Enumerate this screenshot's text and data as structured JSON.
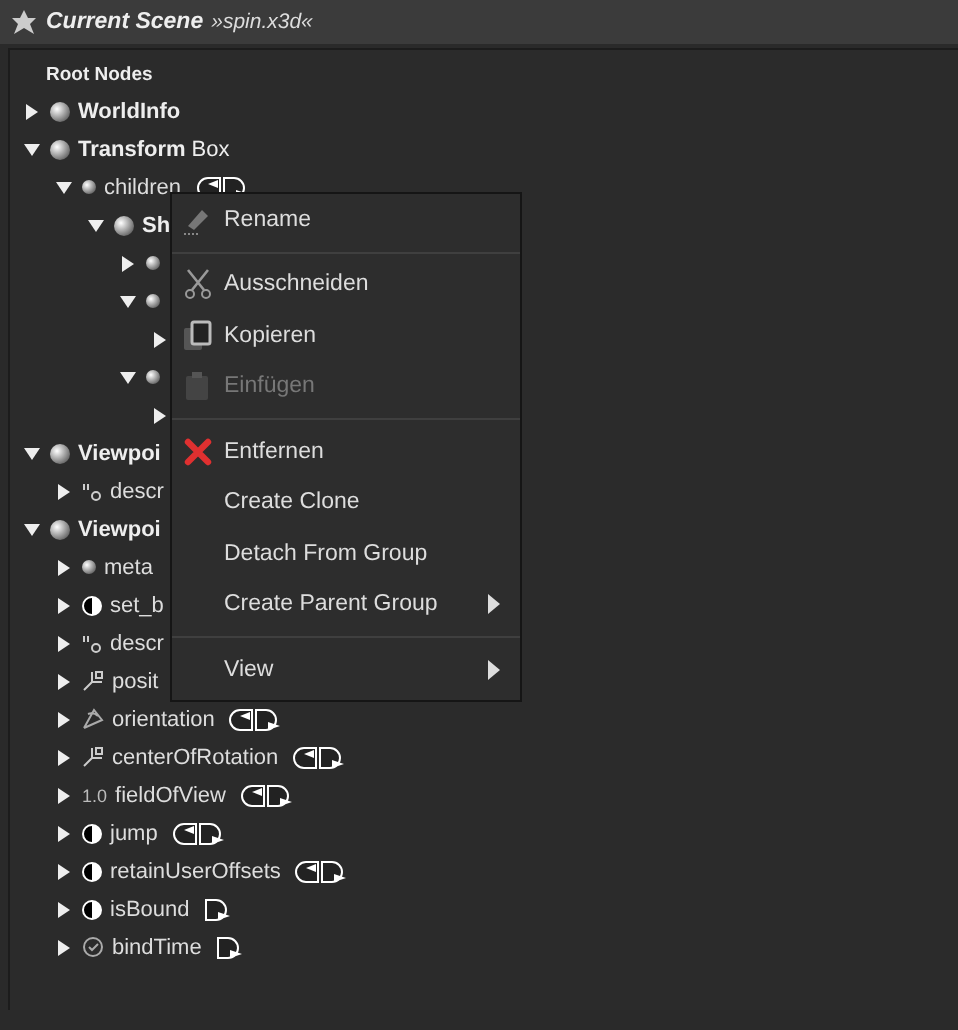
{
  "header": {
    "title": "Current Scene",
    "file": "»spin.x3d«"
  },
  "tree": {
    "heading": "Root Nodes",
    "rows": [
      {
        "kind": "node",
        "type": "WorldInfo",
        "expanded": false
      },
      {
        "kind": "node",
        "type": "Transform",
        "name": "Box",
        "expanded": true,
        "children": [
          {
            "kind": "sfnode",
            "label": "children",
            "input": true,
            "output": true,
            "expanded": true,
            "children": [
              {
                "kind": "node",
                "type": "Sh",
                "expanded": true,
                "children": [
                  {
                    "kind": "sfnode",
                    "expanded": false
                  },
                  {
                    "kind": "sfnode",
                    "expanded": true,
                    "children": [
                      {
                        "expanded": false
                      }
                    ]
                  },
                  {
                    "kind": "sfnode",
                    "expanded": true,
                    "children": [
                      {
                        "expanded": false
                      }
                    ]
                  }
                ]
              }
            ]
          }
        ]
      },
      {
        "kind": "node",
        "type": "Viewpoi",
        "expanded": true,
        "children": [
          {
            "kind": "sfstring",
            "label": "descr",
            "expanded": false
          }
        ]
      },
      {
        "kind": "node",
        "type": "Viewpoi",
        "expanded": true,
        "children": [
          {
            "kind": "sfnode",
            "label": "meta",
            "expanded": false
          },
          {
            "kind": "sfbool",
            "label": "set_b",
            "expanded": false
          },
          {
            "kind": "sfstring",
            "label": "descr",
            "expanded": false
          },
          {
            "kind": "sfvec3f",
            "label": "posit",
            "expanded": false
          },
          {
            "kind": "sfrotation",
            "label": "orientation",
            "input": true,
            "output": true,
            "expanded": false
          },
          {
            "kind": "sfvec3f",
            "label": "centerOfRotation",
            "input": true,
            "output": true,
            "expanded": false
          },
          {
            "kind": "sffloat",
            "badge": "1.0",
            "label": "fieldOfView",
            "input": true,
            "output": true,
            "expanded": false
          },
          {
            "kind": "sfbool",
            "label": "jump",
            "input": true,
            "output": true,
            "expanded": false
          },
          {
            "kind": "sfbool",
            "label": "retainUserOffsets",
            "input": true,
            "output": true,
            "expanded": false
          },
          {
            "kind": "sfbool",
            "label": "isBound",
            "input": false,
            "output": true,
            "expanded": false
          },
          {
            "kind": "sftime",
            "label": "bindTime",
            "input": false,
            "output": true,
            "expanded": false
          }
        ]
      }
    ]
  },
  "context_menu": {
    "groups": [
      [
        {
          "label": "Rename",
          "kind": "rename",
          "disabled": false
        }
      ],
      [
        {
          "label": "Ausschneiden",
          "kind": "cut",
          "disabled": false
        },
        {
          "label": "Kopieren",
          "kind": "copy",
          "disabled": false
        },
        {
          "label": "Einfügen",
          "kind": "paste",
          "disabled": true
        }
      ],
      [
        {
          "label": "Entfernen",
          "kind": "delete",
          "disabled": false
        },
        {
          "label": "Create Clone",
          "disabled": false
        },
        {
          "label": "Detach From Group",
          "disabled": false
        },
        {
          "label": "Create Parent Group",
          "submenu": true,
          "disabled": false
        }
      ],
      [
        {
          "label": "View",
          "submenu": true,
          "disabled": false
        }
      ]
    ]
  }
}
